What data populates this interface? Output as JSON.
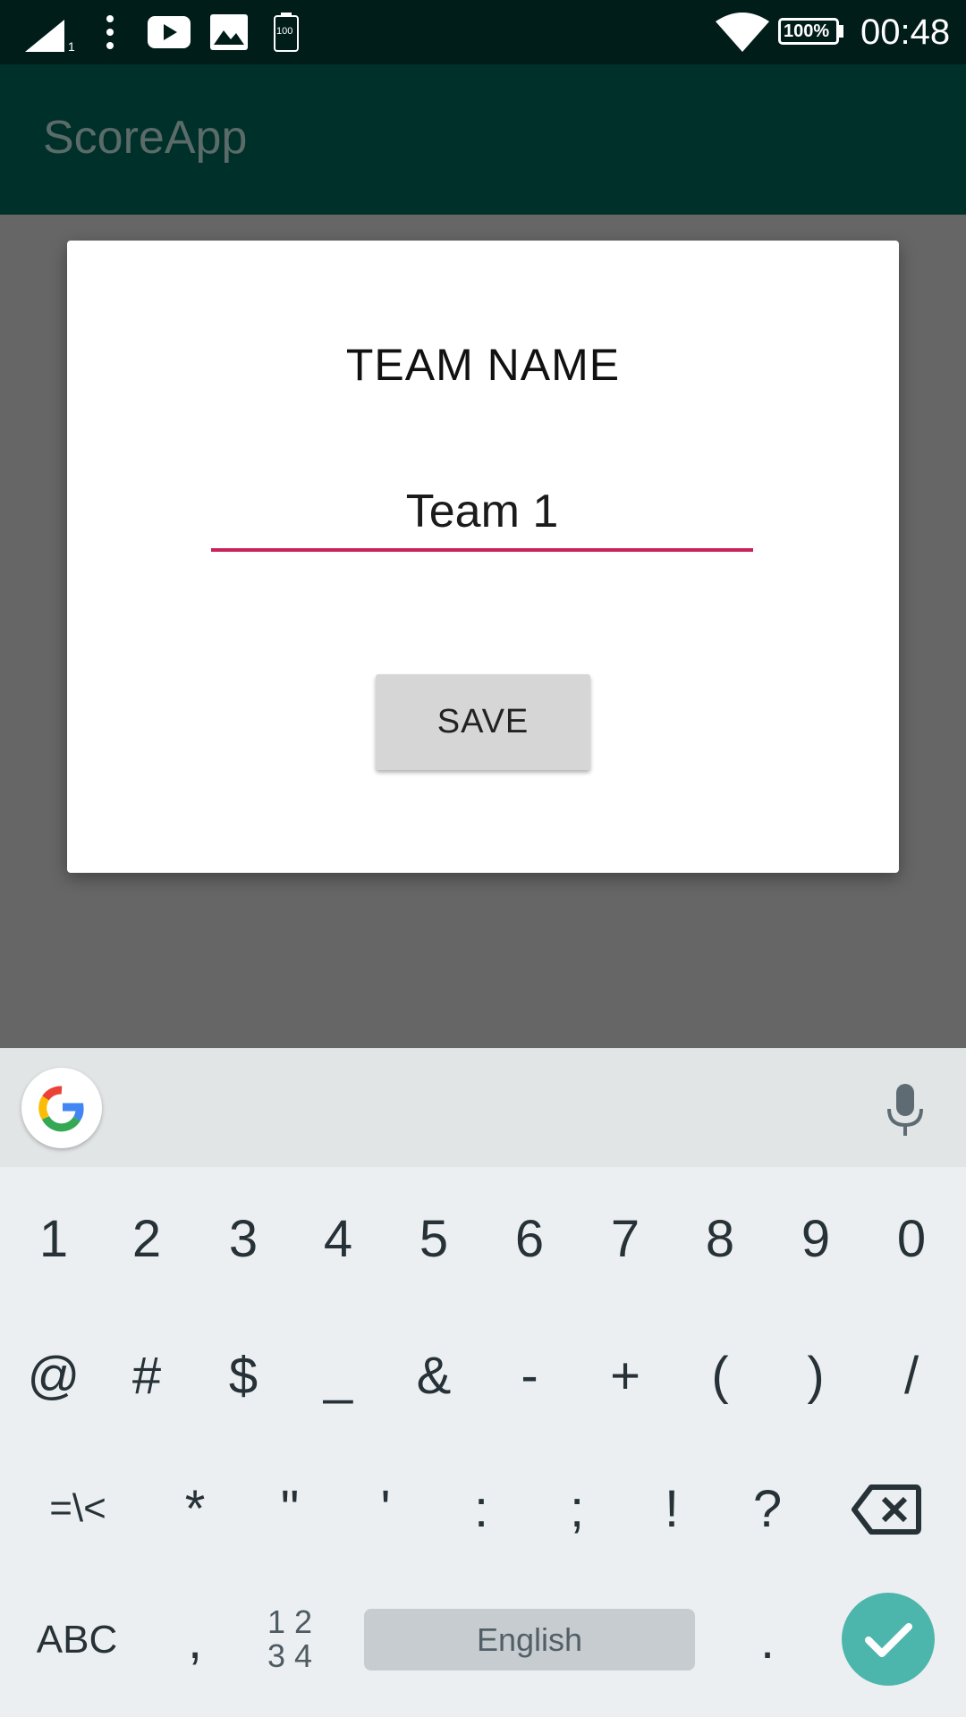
{
  "status_bar": {
    "time": "00:48",
    "battery": "100%",
    "sim_slot": "1",
    "battery_icon_text": "100"
  },
  "app_bar": {
    "title": "ScoreApp"
  },
  "dialog": {
    "title": "TEAM NAME",
    "input_value": "Team 1",
    "save_label": "SAVE"
  },
  "keyboard": {
    "row1": [
      "1",
      "2",
      "3",
      "4",
      "5",
      "6",
      "7",
      "8",
      "9",
      "0"
    ],
    "row2": [
      "@",
      "#",
      "$",
      "_",
      "&",
      "-",
      "+",
      "(",
      ")",
      "/"
    ],
    "row3": [
      "=\\<",
      "*",
      "\"",
      "'",
      ":",
      ";",
      "!",
      "?"
    ],
    "abc_label": "ABC",
    "comma": ",",
    "numpad_label_top": "1 2",
    "numpad_label_bottom": "3 4",
    "space_label": "English",
    "period": "."
  },
  "colors": {
    "status_bar": "#011d19",
    "app_bar": "#00302a",
    "input_underline": "#c8215c",
    "enter_key": "#4db6ac"
  }
}
